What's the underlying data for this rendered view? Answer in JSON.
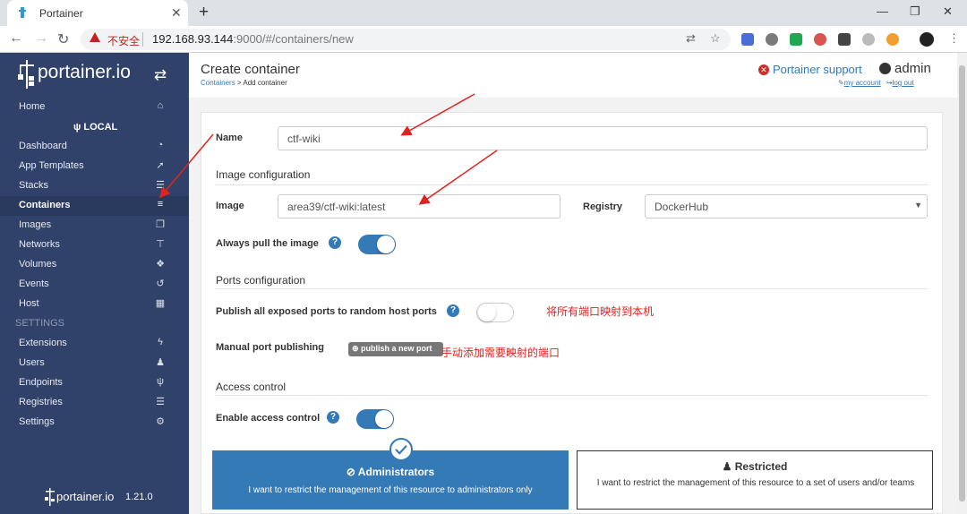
{
  "browser": {
    "tab_title": "Portainer",
    "tab_close": "✕",
    "new_tab": "+",
    "url_warning": "不安全",
    "url_host": "192.168.93.144",
    "url_rest": ":9000/#/containers/new",
    "window_controls": [
      "—",
      "❐",
      "✕"
    ]
  },
  "sidebar": {
    "brand": "portainer.io",
    "local_label": "LOCAL",
    "items": [
      {
        "label": "Home",
        "icon": "home-icon",
        "glyph": "⌂"
      },
      {
        "label": "Dashboard",
        "icon": "tachometer-icon",
        "glyph": "◔"
      },
      {
        "label": "App Templates",
        "icon": "rocket-icon",
        "glyph": "➚"
      },
      {
        "label": "Stacks",
        "icon": "th-list-icon",
        "glyph": "☰"
      },
      {
        "label": "Containers",
        "icon": "server-icon",
        "glyph": "≡",
        "active": true
      },
      {
        "label": "Images",
        "icon": "clone-icon",
        "glyph": "❐"
      },
      {
        "label": "Networks",
        "icon": "sitemap-icon",
        "glyph": "⊤"
      },
      {
        "label": "Volumes",
        "icon": "cubes-icon",
        "glyph": "❖"
      },
      {
        "label": "Events",
        "icon": "history-icon",
        "glyph": "↺"
      },
      {
        "label": "Host",
        "icon": "th-icon",
        "glyph": "▦"
      }
    ],
    "settings_heading": "SETTINGS",
    "settings_items": [
      {
        "label": "Extensions",
        "icon": "bolt-icon",
        "glyph": "ϟ"
      },
      {
        "label": "Users",
        "icon": "users-icon",
        "glyph": "♟"
      },
      {
        "label": "Endpoints",
        "icon": "plug-icon",
        "glyph": "ψ"
      },
      {
        "label": "Registries",
        "icon": "database-icon",
        "glyph": "☰"
      },
      {
        "label": "Settings",
        "icon": "cogs-icon",
        "glyph": "⚙"
      }
    ],
    "footer_brand": "portainer.io",
    "version": "1.21.0"
  },
  "header": {
    "title": "Create container",
    "breadcrumb_link": "Containers",
    "breadcrumb_rest": " > Add container",
    "support": "Portainer support",
    "user": "admin",
    "my_account": "my account",
    "log_out": "log out"
  },
  "form": {
    "name_label": "Name",
    "name_value": "ctf-wiki",
    "image_section": "Image configuration",
    "image_label": "Image",
    "image_value": "area39/ctf-wiki:latest",
    "registry_label": "Registry",
    "registry_value": "DockerHub",
    "always_pull_label": "Always pull the image",
    "always_pull": true,
    "ports_section": "Ports configuration",
    "publish_all_label": "Publish all exposed ports to random host ports",
    "publish_all": false,
    "manual_label": "Manual port publishing",
    "publish_button": "publish a new port",
    "access_section": "Access control",
    "enable_access_label": "Enable access control",
    "enable_access": true,
    "admin_title": "Administrators",
    "admin_desc": "I want to restrict the management of this resource to administrators only",
    "restricted_title": "Restricted",
    "restricted_desc": "I want to restrict the management of this resource to a set of users and/or teams"
  },
  "annotations": {
    "publish_all_note": "将所有端口映射到本机",
    "manual_note": "手动添加需要映射的端口"
  },
  "colors": {
    "sidebar_bg": "#30426a",
    "accent": "#337ab7",
    "annotation": "#e0231e"
  }
}
